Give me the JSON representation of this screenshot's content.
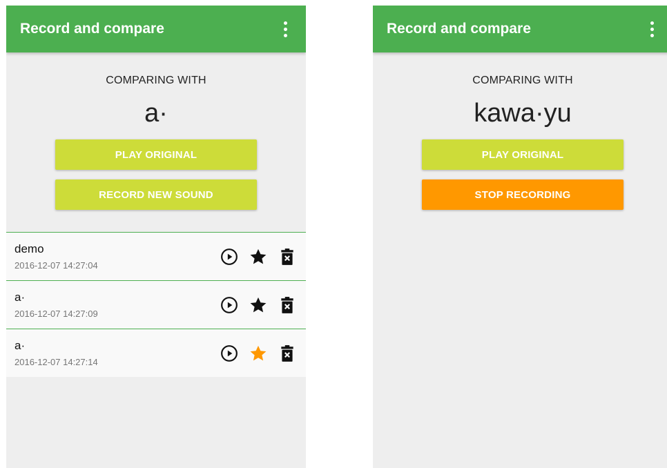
{
  "left": {
    "appbar": {
      "title": "Record and compare"
    },
    "comparing_label": "COMPARING WITH",
    "word": "a·",
    "buttons": {
      "play": "PLAY ORIGINAL",
      "record": "RECORD NEW SOUND"
    },
    "recordings": [
      {
        "title": "demo",
        "timestamp": "2016-12-07 14:27:04",
        "favorite": false
      },
      {
        "title": "a·",
        "timestamp": "2016-12-07 14:27:09",
        "favorite": false
      },
      {
        "title": "a·",
        "timestamp": "2016-12-07 14:27:14",
        "favorite": true
      }
    ]
  },
  "right": {
    "appbar": {
      "title": "Record and compare"
    },
    "comparing_label": "COMPARING WITH",
    "word": "kawa·yu",
    "buttons": {
      "play": "PLAY ORIGINAL",
      "stop": "STOP RECORDING"
    }
  },
  "icons": {
    "menu": "more-vert-icon",
    "play": "play-circle-icon",
    "star": "star-icon",
    "delete": "delete-forever-icon"
  },
  "colors": {
    "appbar": "#4caf50",
    "primary_button": "#cddc39",
    "stop_button": "#ff9800",
    "favorite_star": "#ff9800",
    "default_star": "#111111",
    "background": "#eeeeee"
  }
}
